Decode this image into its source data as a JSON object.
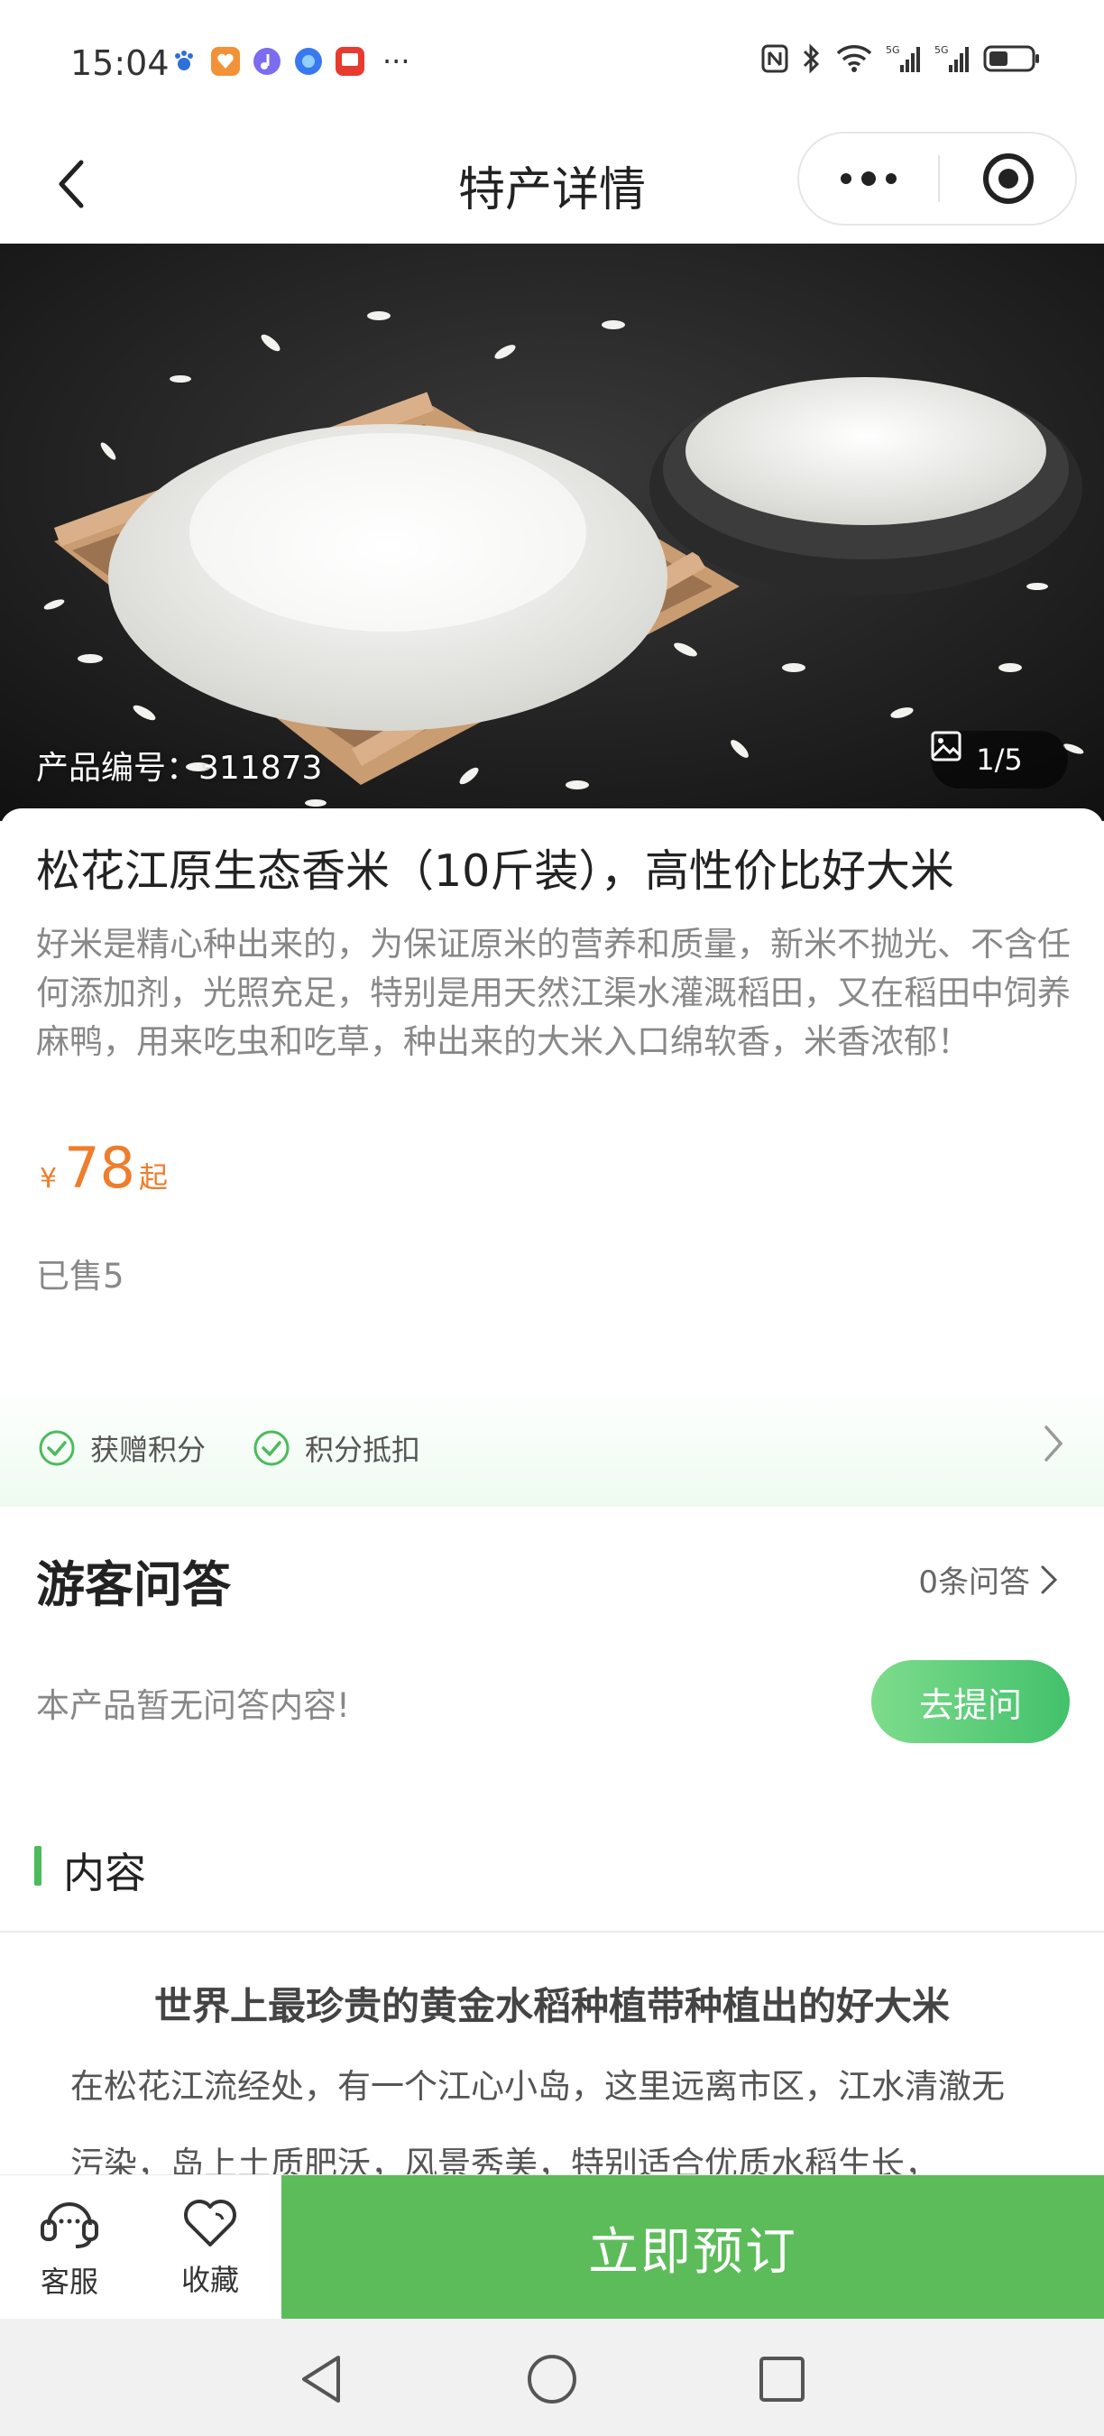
{
  "status_bar": {
    "time": "15:04",
    "app_icons": [
      "baidu-icon",
      "heart-app-icon",
      "music-app-icon",
      "browser-app-icon",
      "taobao-icon"
    ],
    "more": "···",
    "network": "5G"
  },
  "nav": {
    "title": "特产详情"
  },
  "hero": {
    "product_code": "产品编号：311873",
    "counter": "1/5"
  },
  "product": {
    "title": "松花江原生态香米（10斤装），高性价比好大米",
    "description": "好米是精心种出来的，为保证原米的营养和质量，新米不抛光、不含任何添加剂，光照充足，特别是用天然江渠水灌溉稻田，又在稻田中饲养麻鸭，用来吃虫和吃草，种出来的大米入口绵软香，米香浓郁！",
    "currency": "¥",
    "price": "78",
    "price_suffix": "起",
    "sold": "已售5",
    "benefits": [
      "获赠积分",
      "积分抵扣"
    ]
  },
  "qa": {
    "title": "游客问答",
    "count": "0条问答",
    "empty": "本产品暂无问答内容!",
    "ask_button": "去提问"
  },
  "content": {
    "label": "内容",
    "heading": "世界上最珍贵的黄金水稻种植带种植出的好大米",
    "text": "在松花江流经处，有一个江心小岛，这里远离市区，江水清澈无污染，岛上土质肥沃，风景秀美，特别适合优质水稻生长，"
  },
  "actions": {
    "service": "客服",
    "favorite": "收藏",
    "book": "立即预订"
  },
  "colors": {
    "accent_green": "#5cbc5a",
    "price_orange": "#ee7d2c",
    "check_green": "#4cbb5c"
  }
}
